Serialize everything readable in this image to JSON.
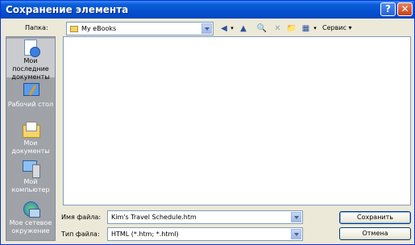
{
  "window": {
    "title": "Сохранение элемента"
  },
  "titlebar": {
    "help_glyph": "?",
    "close_glyph": "✕"
  },
  "toolbar": {
    "look_in_label": "Папка:",
    "look_in_value": "My eBooks",
    "back_glyph": "◀",
    "up_glyph": "▲",
    "search_glyph": "🔍",
    "delete_glyph": "✕",
    "new_folder_glyph": "📁",
    "views_glyph": "▦",
    "service_label": "Сервис ▾"
  },
  "places": [
    {
      "label": "Мои последние документы",
      "icon": "recent-documents-icon"
    },
    {
      "label": "Рабочий стол",
      "icon": "desktop-icon"
    },
    {
      "label": "Мои документы",
      "icon": "my-documents-icon"
    },
    {
      "label": "Мой компьютер",
      "icon": "my-computer-icon"
    },
    {
      "label": "Мое сетевое окружение",
      "icon": "network-places-icon"
    }
  ],
  "form": {
    "file_name_label": "Имя файла:",
    "file_name_value": "Kim's Travel Schedule.htm",
    "file_type_label": "Тип файла:",
    "file_type_value": "HTML (*.htm; *.html)"
  },
  "buttons": {
    "save": "Сохранить",
    "cancel": "Отмена"
  },
  "colors": {
    "titlebar": "#0a5fd8",
    "places_bar": "#9fa2a7",
    "face": "#ece9d8"
  }
}
